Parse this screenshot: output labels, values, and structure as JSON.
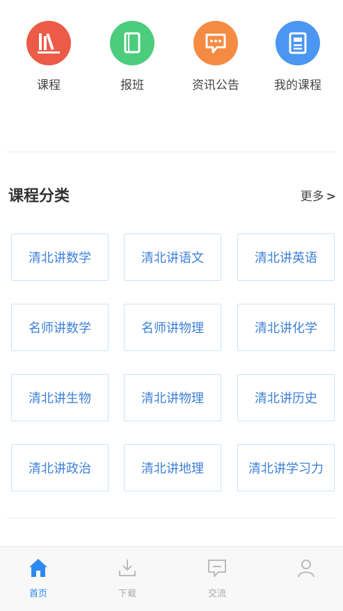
{
  "colors": {
    "accent": "#2d8af0",
    "red": "#ec5b47",
    "green": "#4ccc7d",
    "orange": "#f58b42",
    "blue": "#4b96f0"
  },
  "shortcuts": [
    {
      "label": "课程",
      "icon": "books-icon"
    },
    {
      "label": "报班",
      "icon": "book-icon"
    },
    {
      "label": "资讯公告",
      "icon": "chat-bubble-icon"
    },
    {
      "label": "我的课程",
      "icon": "document-icon"
    }
  ],
  "section": {
    "title": "课程分类",
    "more_label": "更多",
    "more_arrow": ">"
  },
  "categories": [
    "清北讲数学",
    "清北讲语文",
    "清北讲英语",
    "名师讲数学",
    "名师讲物理",
    "清北讲化学",
    "清北讲生物",
    "清北讲物理",
    "清北讲历史",
    "清北讲政治",
    "清北讲地理",
    "清北讲学习力"
  ],
  "tabbar": [
    {
      "label": "首页",
      "active": true
    },
    {
      "label": "下载",
      "active": false
    },
    {
      "label": "交流",
      "active": false
    },
    {
      "label": "",
      "active": false
    }
  ]
}
